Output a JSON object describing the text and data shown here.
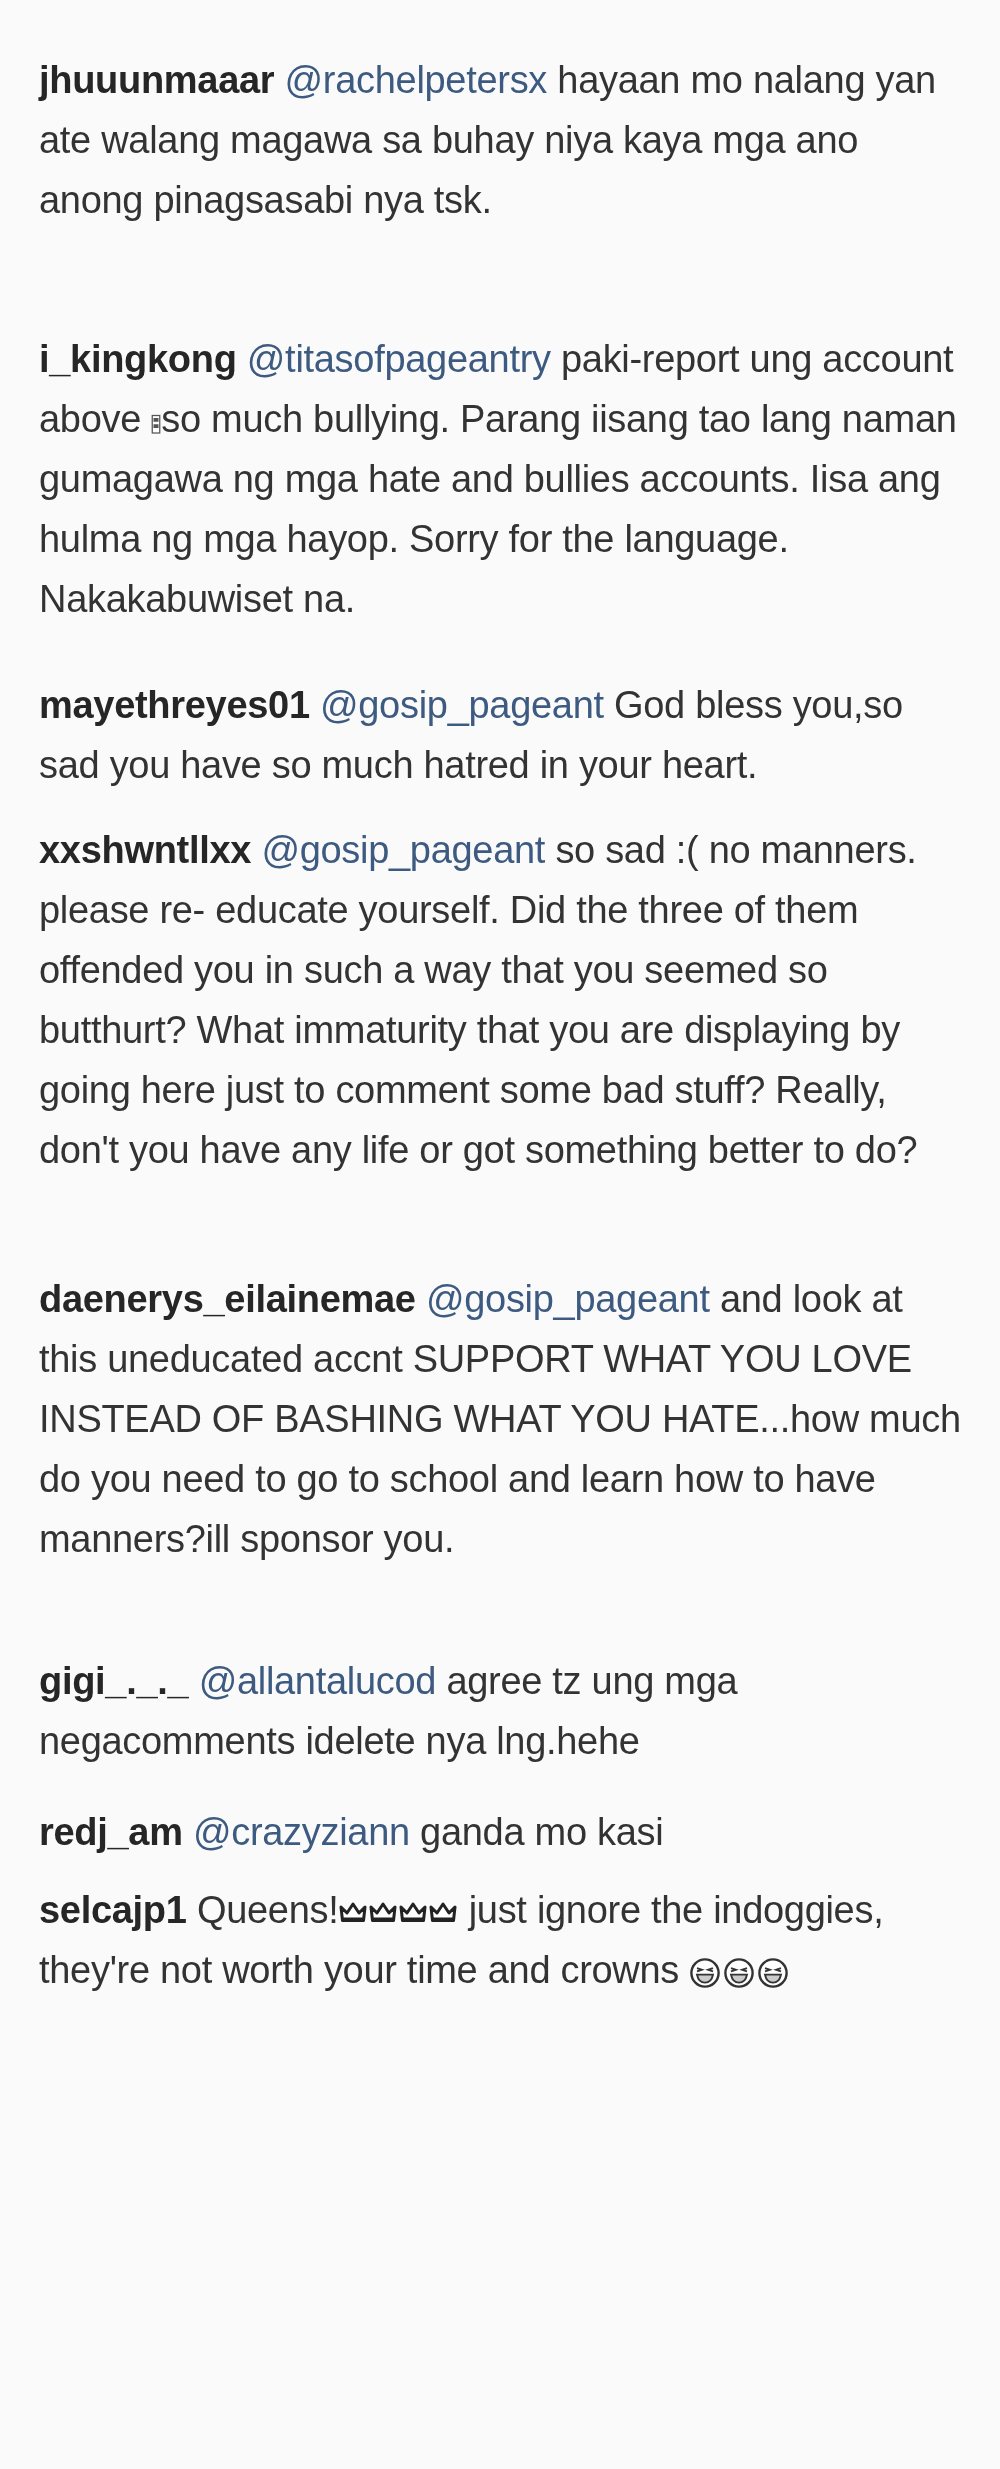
{
  "comments": [
    {
      "username": "jhuuunmaaar",
      "mention": "@rachelpetersx",
      "body": [
        {
          "kind": "text",
          "text": "hayaan mo nalang yan ate walang magawa sa buhay niya kaya mga ano anong pinagsasabi nya tsk."
        }
      ]
    },
    {
      "username": "i_kingkong",
      "mention": "@titasofpageantry",
      "body": [
        {
          "kind": "text",
          "text": "paki-report ung account above "
        },
        {
          "kind": "symbol"
        },
        {
          "kind": "text",
          "text": "so much bullying. Parang iisang tao lang naman gumagawa ng mga hate and bullies accounts. Iisa ang hulma ng mga hayop. Sorry for the language. Nakakabuwiset na."
        }
      ]
    },
    {
      "username": "mayethreyes01",
      "mention": "@gosip_pageant",
      "body": [
        {
          "kind": "text",
          "text": "God bless you,so sad you have so much hatred in your heart."
        }
      ]
    },
    {
      "username": "xxshwntllxx",
      "mention": "@gosip_pageant",
      "body": [
        {
          "kind": "text",
          "text": "so sad :( no manners. please re- educate yourself. Did the three of them offended you in such a way that you seemed so butthurt? What immaturity that you are displaying by going here just to comment some bad stuff? Really, don't you have any life or got something better to do?"
        }
      ]
    },
    {
      "username": "daenerys_eilainemae",
      "mention": "@gosip_pageant",
      "body": [
        {
          "kind": "text",
          "text": "and look at this uneducated accnt SUPPORT WHAT YOU LOVE INSTEAD OF BASHING WHAT YOU HATE...how much do you need to go to school and learn how to have manners?ill sponsor you."
        }
      ]
    },
    {
      "username": "gigi_._._",
      "mention": "@allantalucod",
      "body": [
        {
          "kind": "text",
          "text": "agree tz ung mga negacomments idelete nya lng.hehe"
        }
      ]
    },
    {
      "username": "redj_am",
      "mention": "@crazyziann",
      "body": [
        {
          "kind": "text",
          "text": "ganda mo kasi"
        }
      ]
    },
    {
      "username": "selcajp1",
      "body": [
        {
          "kind": "text",
          "text": "Queens!"
        },
        {
          "kind": "crown"
        },
        {
          "kind": "crown"
        },
        {
          "kind": "crown"
        },
        {
          "kind": "crown"
        },
        {
          "kind": "text",
          "text": " just ignore the indoggies, they're not worth your time and crowns "
        },
        {
          "kind": "laugh"
        },
        {
          "kind": "laugh"
        },
        {
          "kind": "laugh"
        }
      ]
    }
  ]
}
